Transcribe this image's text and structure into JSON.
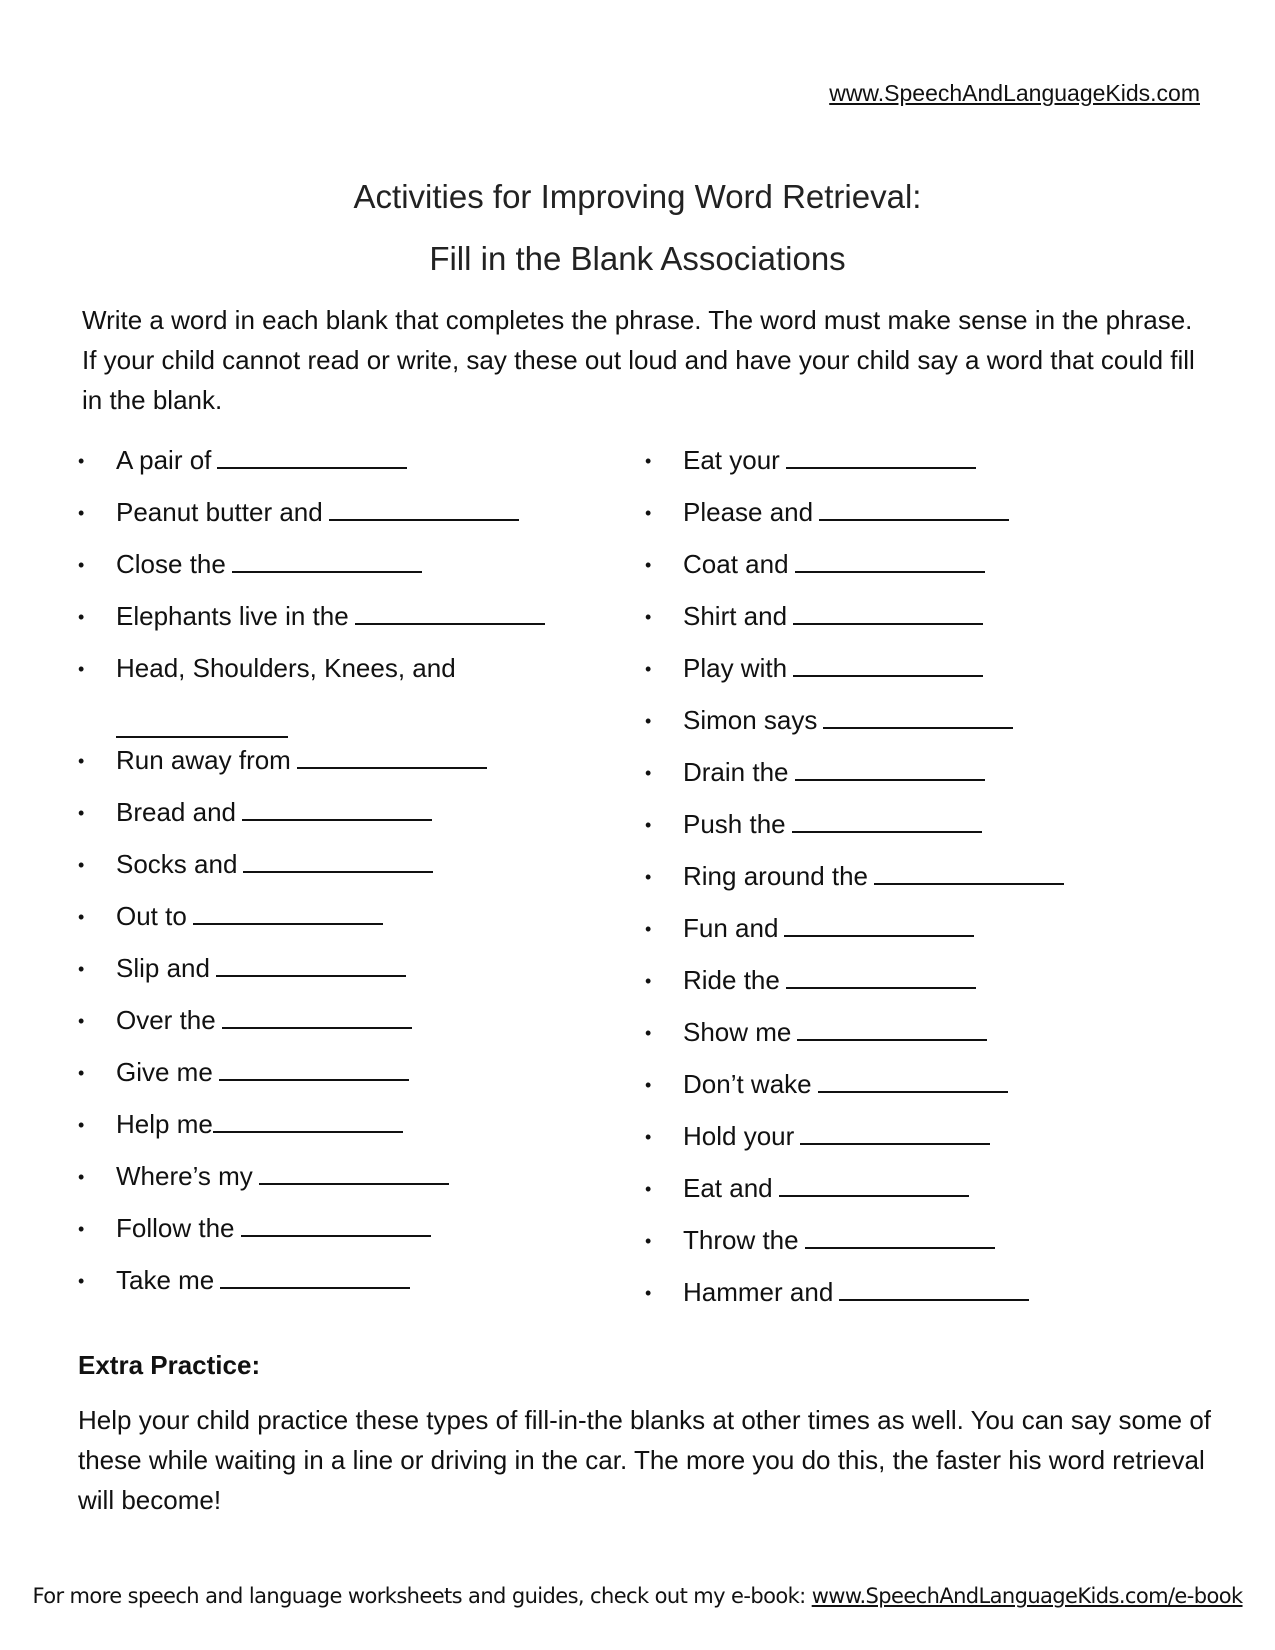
{
  "header": {
    "site_link": "www.SpeechAndLanguageKids.com"
  },
  "title": {
    "line1": "Activities for Improving Word Retrieval:",
    "line2": "Fill in the Blank Associations"
  },
  "instructions": "Write a word in each blank that completes the phrase.  The word must make sense in the phrase.  If your child cannot read or write, say these out loud and have your child say a word that could fill in the blank.",
  "bullet_icon": "bullet-dot",
  "left_column": [
    {
      "prompt": "A pair of"
    },
    {
      "prompt": "Peanut butter and"
    },
    {
      "prompt": "Close the"
    },
    {
      "prompt": "Elephants live in the"
    },
    {
      "prompt": "Head, Shoulders, Knees, and"
    },
    {
      "prompt": "Run away from"
    },
    {
      "prompt": "Bread and"
    },
    {
      "prompt": "Socks and"
    },
    {
      "prompt": "Out to"
    },
    {
      "prompt": "Slip and"
    },
    {
      "prompt": "Over the"
    },
    {
      "prompt": "Give me"
    },
    {
      "prompt": "Help me"
    },
    {
      "prompt": "Where’s my"
    },
    {
      "prompt": "Follow the"
    },
    {
      "prompt": "Take me"
    }
  ],
  "right_column": [
    {
      "prompt": "Eat your"
    },
    {
      "prompt": "Please and"
    },
    {
      "prompt": "Coat and"
    },
    {
      "prompt": "Shirt and"
    },
    {
      "prompt": "Play with"
    },
    {
      "prompt": "Simon says"
    },
    {
      "prompt": "Drain the"
    },
    {
      "prompt": "Push the"
    },
    {
      "prompt": "Ring around the"
    },
    {
      "prompt": "Fun and"
    },
    {
      "prompt": "Ride the"
    },
    {
      "prompt": "Show me"
    },
    {
      "prompt": "Don’t wake"
    },
    {
      "prompt": "Hold your"
    },
    {
      "prompt": "Eat and"
    },
    {
      "prompt": "Throw the"
    },
    {
      "prompt": "Hammer and"
    }
  ],
  "extra_practice": {
    "heading": "Extra Practice:",
    "body": "Help your child practice these types of fill-in-the blanks at other times as well.  You can say some of these while waiting in a line or driving in the car.  The more you do this, the faster his word retrieval will become!"
  },
  "footer": {
    "text": "For more speech and language worksheets and guides, check out my e-book: ",
    "link": "www.SpeechAndLanguageKids.com/e-book"
  }
}
